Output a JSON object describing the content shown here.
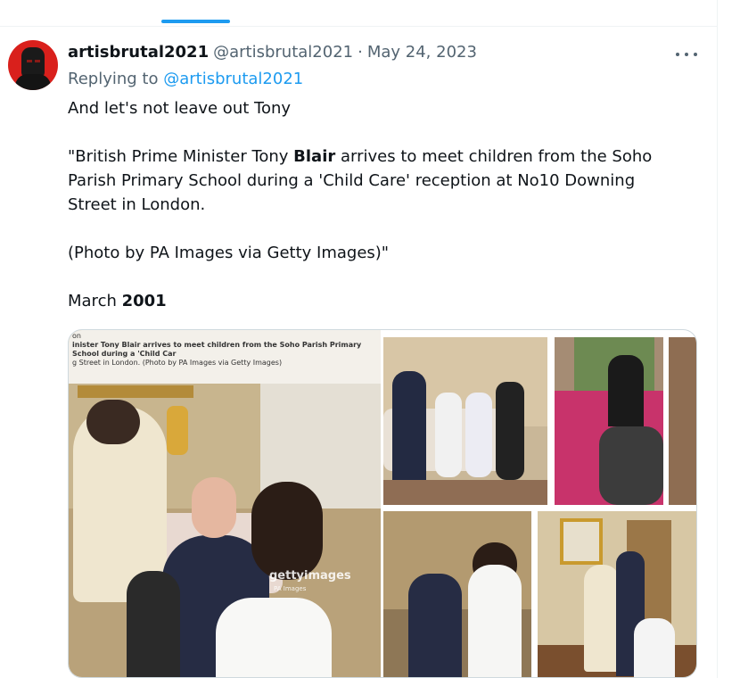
{
  "tweet": {
    "display_name": "artisbrutal2021",
    "handle": "@artisbrutal2021",
    "separator": "·",
    "date": "May 24, 2023",
    "reply_prefix": "Replying to",
    "reply_to": "@artisbrutal2021",
    "line1": "And let's not leave out Tony",
    "quote_l1_a": "\"British Prime Minister Tony ",
    "quote_l1_b": "Blair",
    "quote_l1_c": " arrives to meet children from the Soho",
    "quote_l2": "Parish Primary School during a 'Child Care' reception at No10 Downing",
    "quote_l3": "Street in London.",
    "credit": "(Photo by PA Images via Getty Images)\"",
    "month": "March ",
    "year": "2001"
  },
  "media": {
    "caption_l0": "on",
    "caption_l1": "inister Tony Blair arrives to meet children from the Soho Parish Primary School during a 'Child Car",
    "caption_l2": "g Street in London. (Photo by PA Images via Getty Images)",
    "watermark": "gettyimages",
    "watermark_sub": "PA Images"
  },
  "colors": {
    "accent": "#1d9bf0",
    "secondary_text": "#536471",
    "primary_text": "#0f1419",
    "avatar_bg": "#d9201c"
  },
  "icons": [
    "more-options-icon"
  ]
}
